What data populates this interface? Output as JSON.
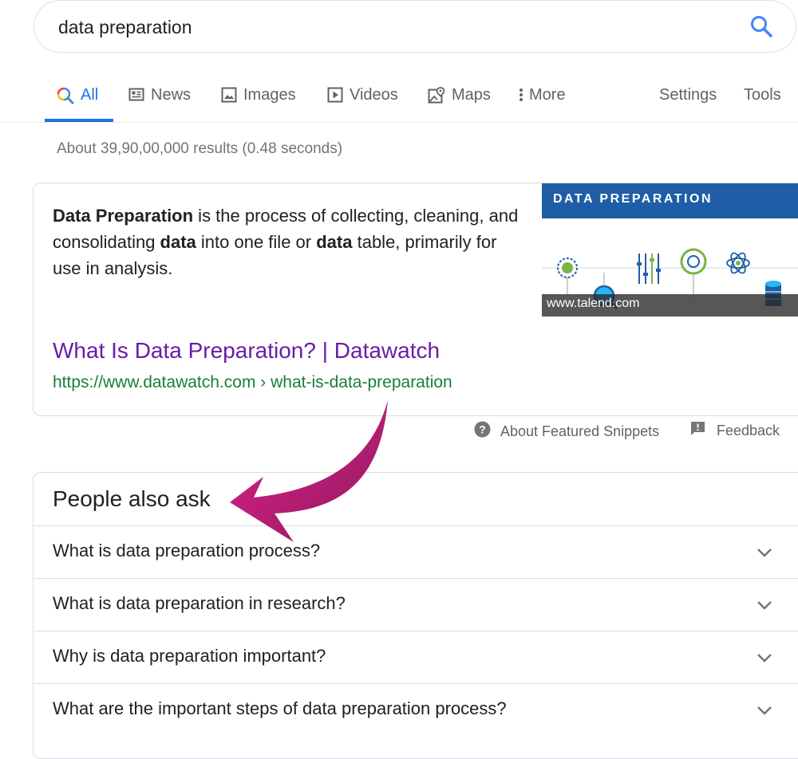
{
  "search": {
    "query": "data preparation"
  },
  "tabs": {
    "all": "All",
    "news": "News",
    "images": "Images",
    "videos": "Videos",
    "maps": "Maps",
    "more": "More",
    "settings": "Settings",
    "tools": "Tools"
  },
  "stats": "About 39,90,00,000 results (0.48 seconds)",
  "featured": {
    "snippet_bold1": "Data Preparation",
    "snippet_text1": " is the process of collecting, cleaning, and consolidating ",
    "snippet_bold2": "data",
    "snippet_text2": " into one file or ",
    "snippet_bold3": "data",
    "snippet_text3": " table, primarily for use in analysis.",
    "image_heading": "DATA PREPARATION",
    "image_source": "www.talend.com",
    "title": "What Is Data Preparation? | Datawatch",
    "url": "https://www.datawatch.com › what-is-data-preparation"
  },
  "snippet_footer": {
    "about": "About Featured Snippets",
    "feedback": "Feedback"
  },
  "people_also_ask": {
    "heading": "People also ask",
    "questions": [
      "What is data preparation process?",
      "What is data preparation in research?",
      "Why is data preparation important?",
      "What are the important steps of data preparation process?"
    ]
  },
  "colors": {
    "link": "#681da8",
    "url": "#188038",
    "accent": "#1a73e8",
    "annotation_arrow": "#c2187a"
  }
}
